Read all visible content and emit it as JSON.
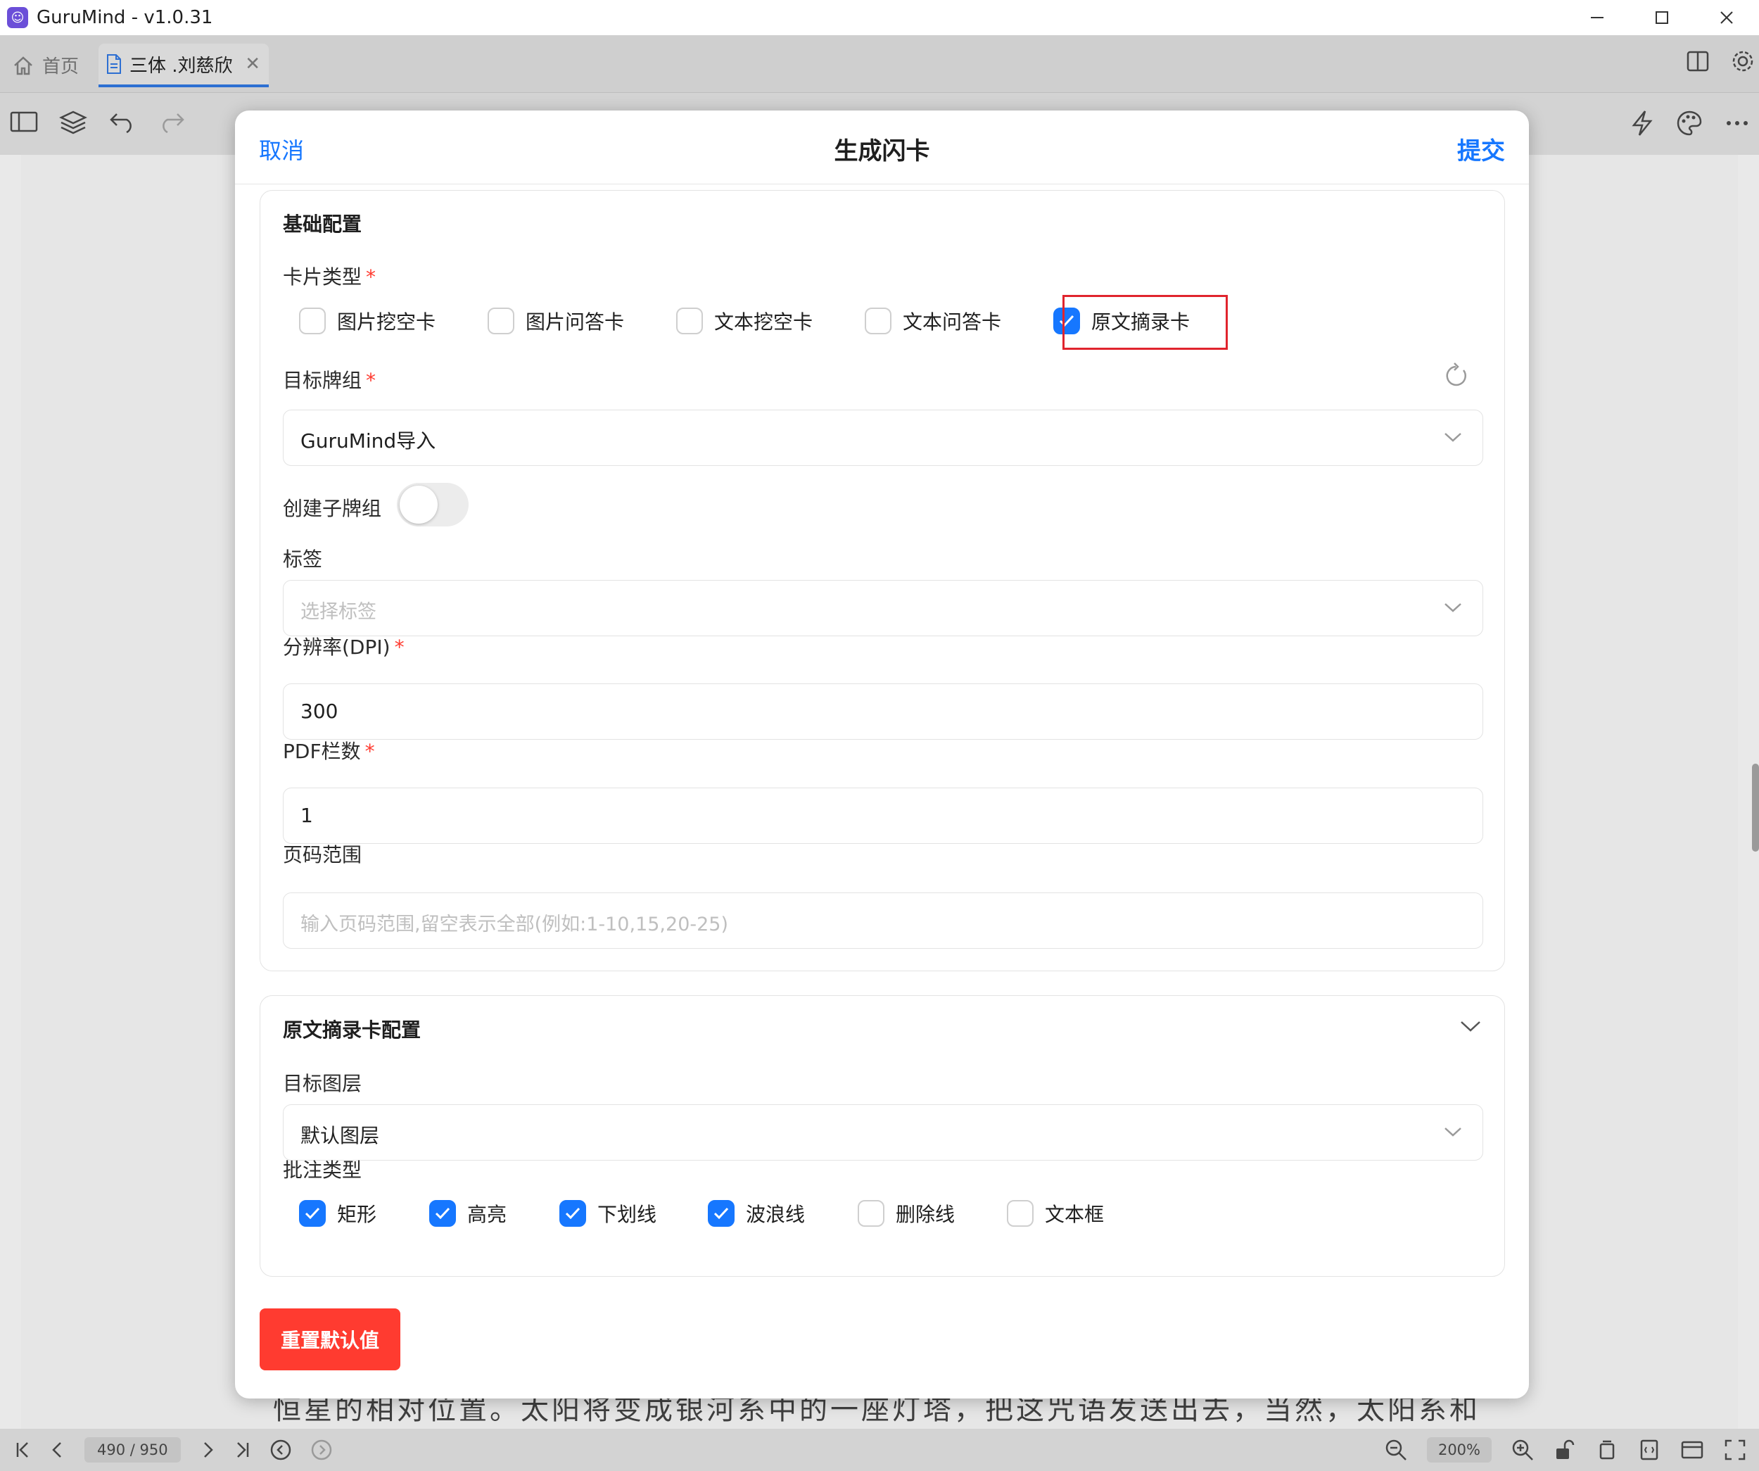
{
  "window": {
    "title": "GuruMind - v1.0.31"
  },
  "tabs": {
    "home_label": "首页",
    "doc_label": "三体 .刘慈欣"
  },
  "statusbar": {
    "page": "490 / 950",
    "zoom": "200%"
  },
  "document": {
    "visible_text": "恒星的相对位置。太阳将变成银河系中的一座灯塔，把这咒语发送出去，当然，太阳系和"
  },
  "modal": {
    "cancel_label": "取消",
    "title": "生成闪卡",
    "submit_label": "提交",
    "basic": {
      "section_title": "基础配置",
      "card_type_label": "卡片类型",
      "card_types": [
        {
          "label": "图片挖空卡",
          "checked": false
        },
        {
          "label": "图片问答卡",
          "checked": false
        },
        {
          "label": "文本挖空卡",
          "checked": false
        },
        {
          "label": "文本问答卡",
          "checked": false
        },
        {
          "label": "原文摘录卡",
          "checked": true
        }
      ],
      "target_deck_label": "目标牌组",
      "target_deck_value": "GuruMind导入",
      "create_subdeck_label": "创建子牌组",
      "create_subdeck_on": false,
      "tags_label": "标签",
      "tags_placeholder": "选择标签",
      "dpi_label": "分辨率(DPI)",
      "dpi_value": "300",
      "columns_label": "PDF栏数",
      "columns_value": "1",
      "page_range_label": "页码范围",
      "page_range_placeholder": "输入页码范围,留空表示全部(例如:1-10,15,20-25)",
      "required_mark": "*"
    },
    "excerpt": {
      "section_title": "原文摘录卡配置",
      "target_layer_label": "目标图层",
      "target_layer_value": "默认图层",
      "annotation_type_label": "批注类型",
      "annotation_types": [
        {
          "label": "矩形",
          "checked": true
        },
        {
          "label": "高亮",
          "checked": true
        },
        {
          "label": "下划线",
          "checked": true
        },
        {
          "label": "波浪线",
          "checked": true
        },
        {
          "label": "删除线",
          "checked": false
        },
        {
          "label": "文本框",
          "checked": false
        }
      ]
    },
    "reset_label": "重置默认值"
  },
  "colors": {
    "accent": "#1677ff",
    "danger": "#ff3b30",
    "highlight_border": "#e0242d"
  }
}
